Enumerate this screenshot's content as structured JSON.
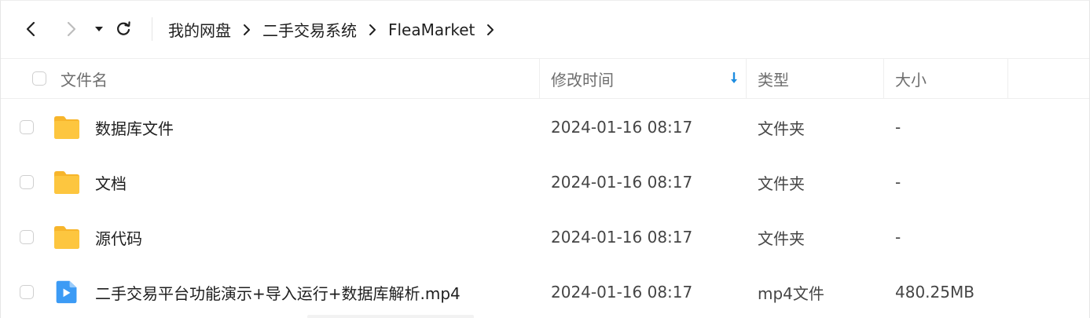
{
  "breadcrumb": {
    "items": [
      "我的网盘",
      "二手交易系统",
      "FleaMarket"
    ]
  },
  "icons": {
    "back": "chevron-left-icon",
    "forward": "chevron-right-icon",
    "history": "caret-down-icon",
    "refresh": "refresh-icon",
    "folder": "folder-icon",
    "video": "video-file-icon",
    "sort": "sort-down-icon"
  },
  "colors": {
    "folder": "#FDC63F",
    "video": "#3C9BF5",
    "sort_accent": "#1E8DE0"
  },
  "table": {
    "columns": {
      "name": "文件名",
      "modified": "修改时间",
      "type": "类型",
      "size": "大小"
    },
    "rows": [
      {
        "name": "数据库文件",
        "modified": "2024-01-16 08:17",
        "type": "文件夹",
        "size": "-",
        "icon": "folder"
      },
      {
        "name": "文档",
        "modified": "2024-01-16 08:17",
        "type": "文件夹",
        "size": "-",
        "icon": "folder"
      },
      {
        "name": "源代码",
        "modified": "2024-01-16 08:17",
        "type": "文件夹",
        "size": "-",
        "icon": "folder"
      },
      {
        "name": "二手交易平台功能演示+导入运行+数据库解析.mp4",
        "modified": "2024-01-16 08:17",
        "type": "mp4文件",
        "size": "480.25MB",
        "icon": "video"
      }
    ]
  }
}
